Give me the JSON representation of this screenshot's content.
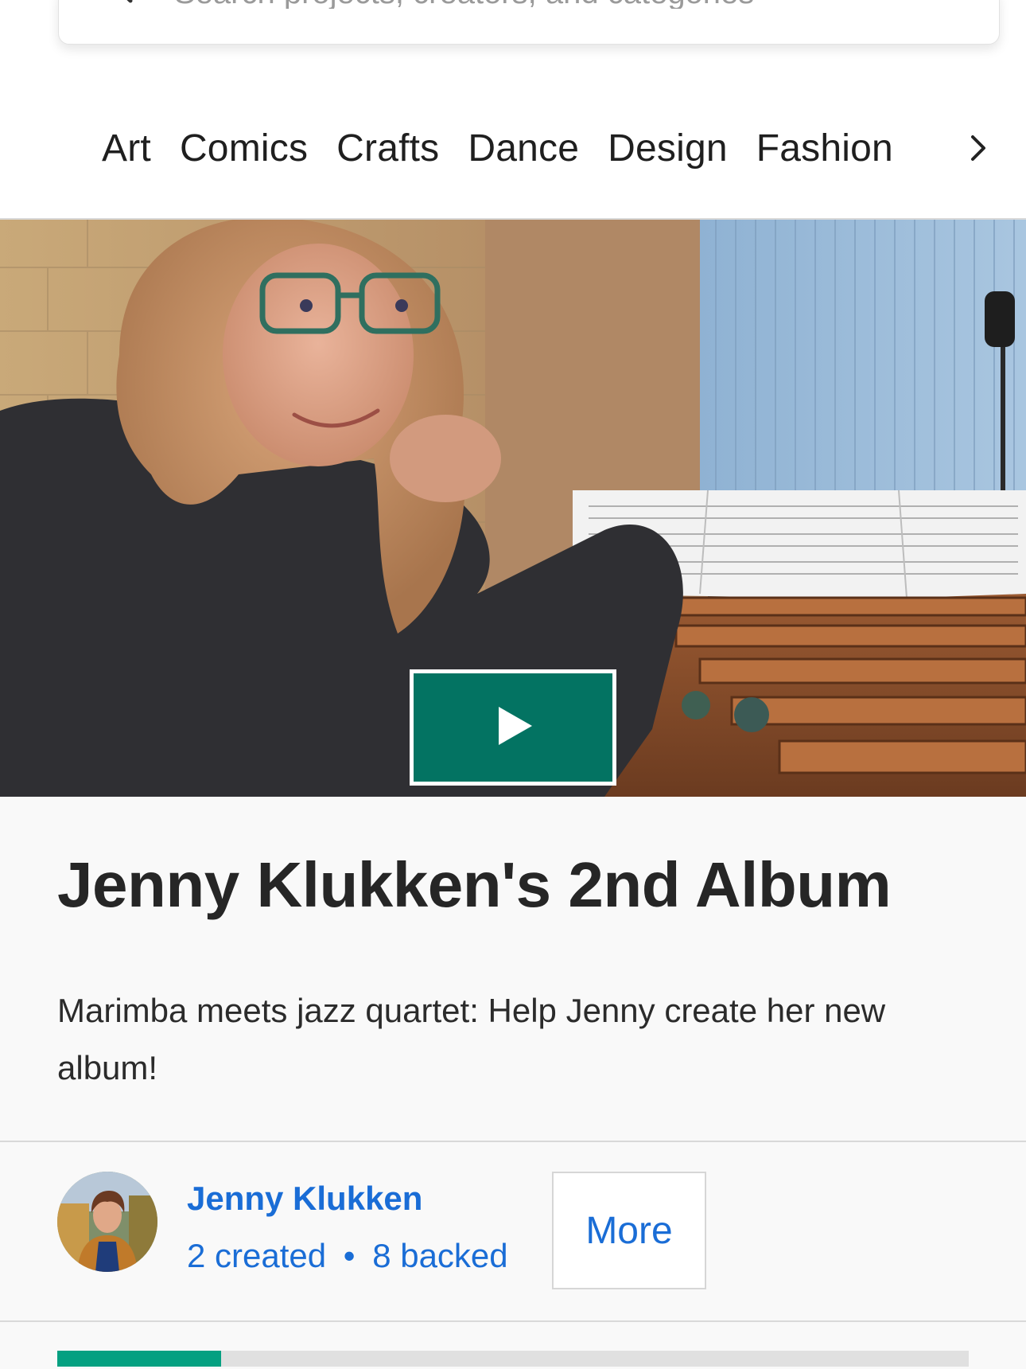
{
  "search": {
    "placeholder": "Search projects, creators, and categories"
  },
  "categories": [
    {
      "label": "Art"
    },
    {
      "label": "Comics"
    },
    {
      "label": "Crafts"
    },
    {
      "label": "Dance"
    },
    {
      "label": "Design"
    },
    {
      "label": "Fashion"
    }
  ],
  "icons": {
    "search": "search-icon",
    "next": "chevron-right-icon",
    "play": "play-icon"
  },
  "project": {
    "title": "Jenny Klukken's 2nd Album",
    "blurb": "Marimba meets jazz quartet: Help Jenny create her new album!"
  },
  "creator": {
    "name": "Jenny Klukken",
    "created": "2 created",
    "separator": "•",
    "backed": "8 backed",
    "more_label": "More"
  },
  "funding": {
    "progress_fraction": 0.18
  },
  "colors": {
    "link_blue": "#1a6dd6",
    "play_green": "#037362",
    "progress_green": "#05a081"
  }
}
